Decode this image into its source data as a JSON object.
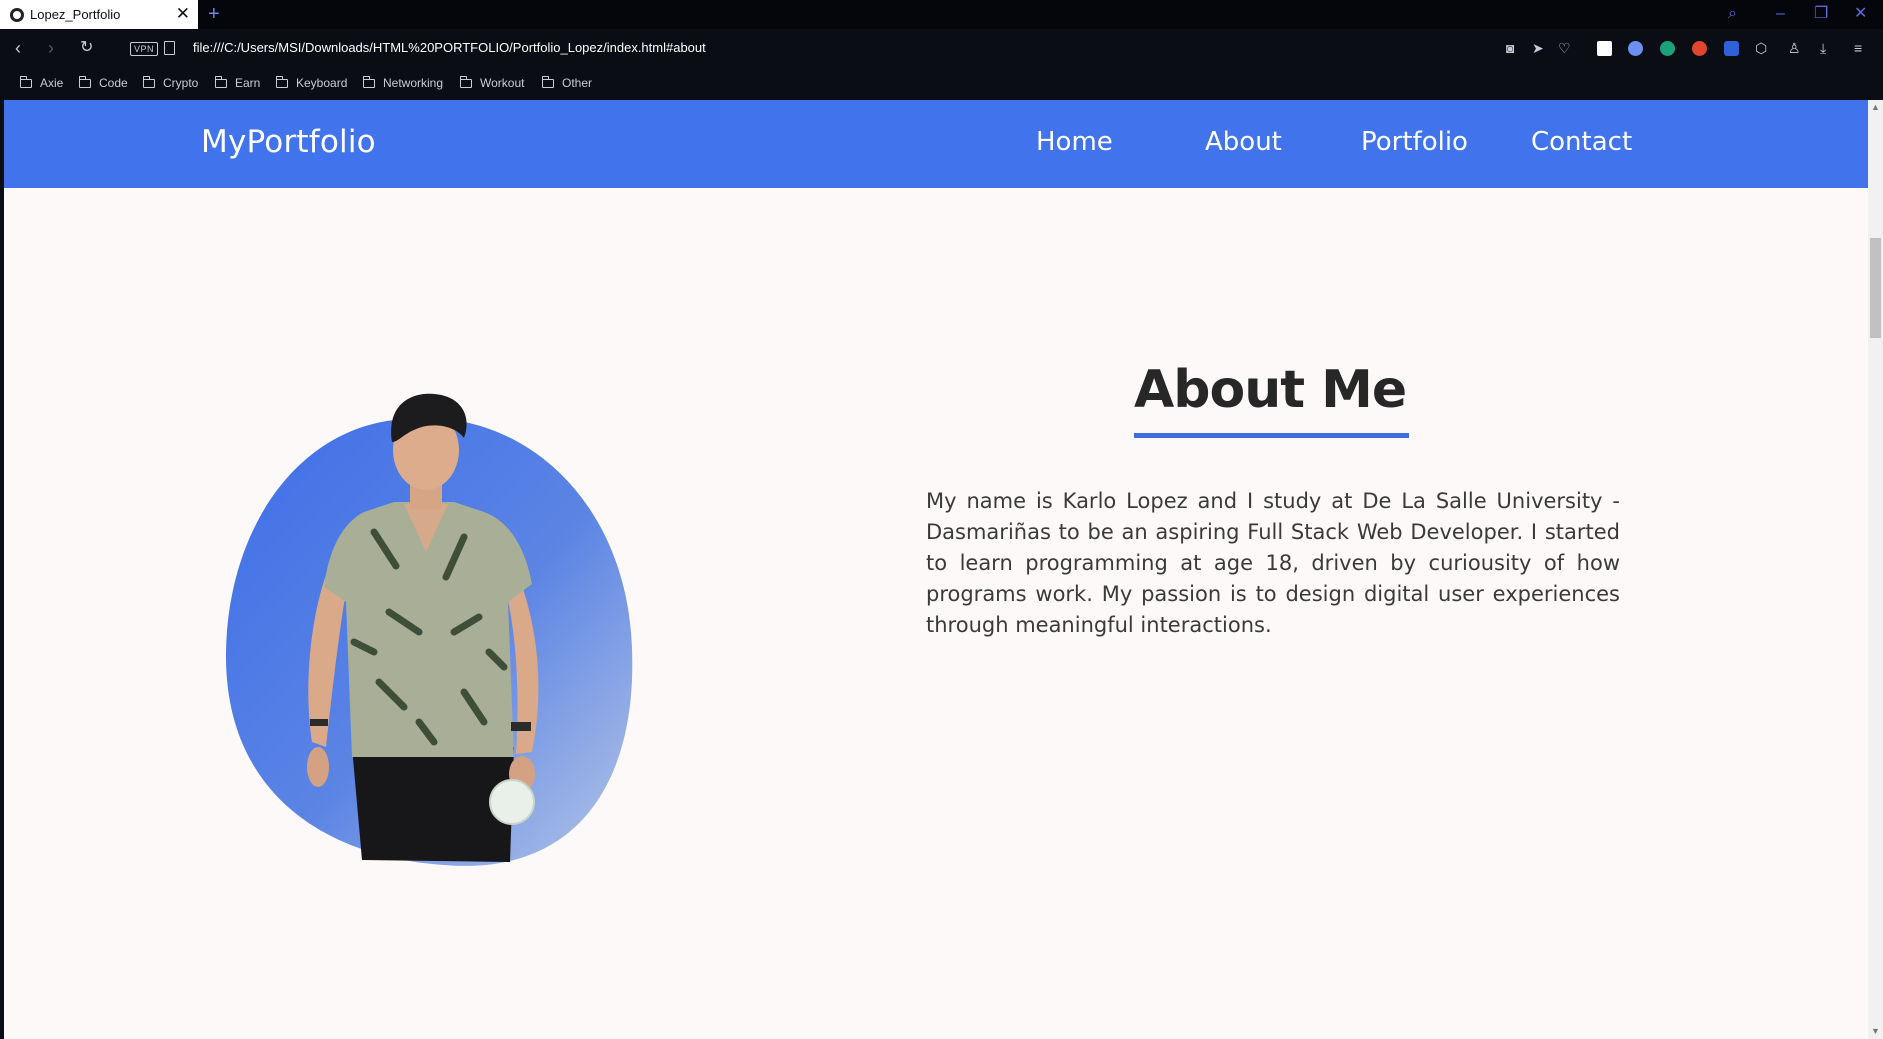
{
  "browser": {
    "tab_title": "Lopez_Portfolio",
    "tab_close": "✕",
    "new_tab": "+",
    "url": "file:///C:/Users/MSI/Downloads/HTML%20PORTFOLIO/Portfolio_Lopez/index.html#about",
    "vpn_label": "VPN",
    "bookmarks": [
      "Axie",
      "Code",
      "Crypto",
      "Earn",
      "Keyboard",
      "Networking",
      "Workout",
      "Other"
    ],
    "accent_color": "#5a6ad8"
  },
  "site": {
    "logo": "MyPortfolio",
    "nav": [
      "Home",
      "About",
      "Portfolio",
      "Contact"
    ],
    "nav_color": "#4173ec"
  },
  "about": {
    "title": "About Me",
    "paragraph": "My name is Karlo Lopez and I study at De La Salle University - Dasmariñas to be an aspiring Full Stack Web Developer. I started to learn programming at age 18, driven by curiousity of how programs work. My passion is to design digital user experiences through meaningful interactions.",
    "underline_color": "#3f6ee0"
  },
  "icons": {
    "search": "search-icon",
    "minimize": "minimize-icon",
    "restore": "restore-icon",
    "close": "close-icon",
    "back": "back-arrow-icon",
    "forward": "forward-arrow-icon",
    "reload": "reload-icon",
    "camera": "camera-icon",
    "send": "send-icon",
    "heart": "heart-icon",
    "download": "download-icon",
    "menu": "menu-icon"
  }
}
